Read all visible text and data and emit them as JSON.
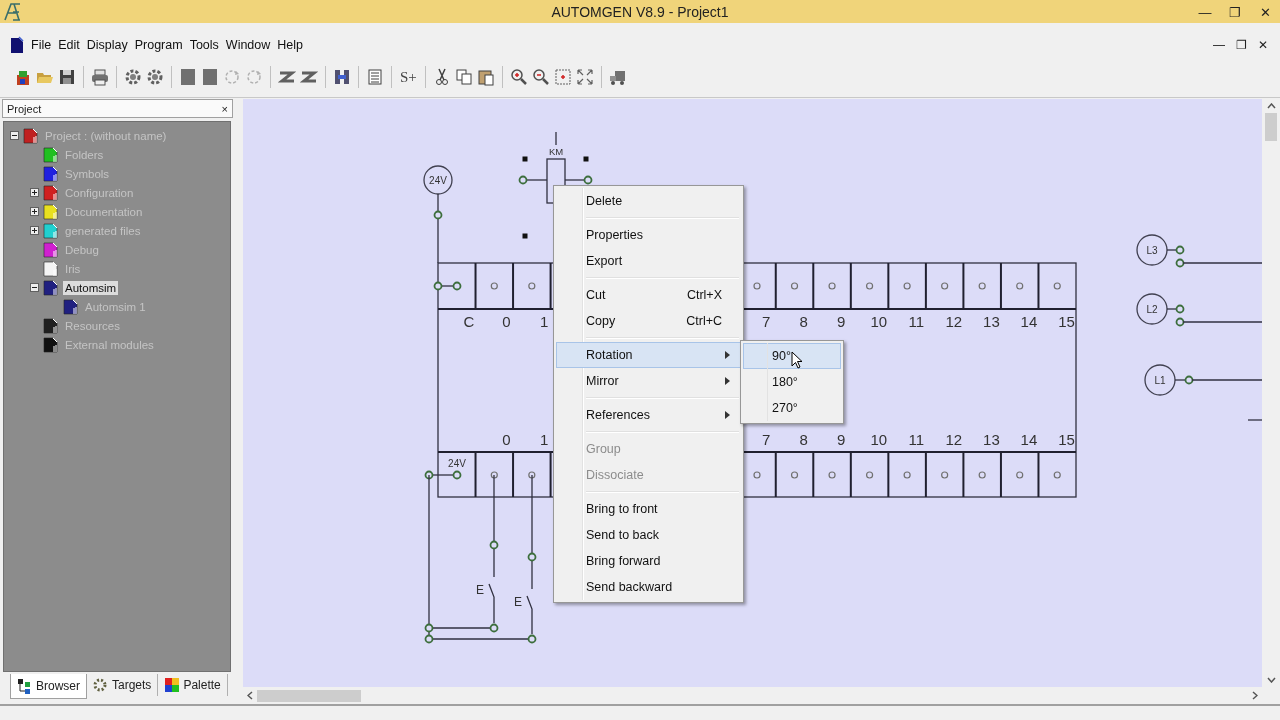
{
  "window": {
    "title": "AUTOMGEN V8.9 - Project1",
    "controls": [
      "—",
      "❐",
      "✕"
    ]
  },
  "menu_bar": {
    "items": [
      "File",
      "Edit",
      "Display",
      "Program",
      "Tools",
      "Window",
      "Help"
    ],
    "mdi_controls": [
      "—",
      "❐",
      "✕"
    ]
  },
  "toolbar": {
    "symbol_button": "S+"
  },
  "project_panel": {
    "title": "Project",
    "close": "×",
    "tree": [
      {
        "label": "Project : (without name)",
        "color": "#c02020",
        "expanded": true,
        "selected": false,
        "children": [
          {
            "label": "Folders",
            "color": "#20c020",
            "selected": false
          },
          {
            "label": "Symbols",
            "color": "#2020e0",
            "selected": false
          },
          {
            "label": "Configuration",
            "color": "#d02020",
            "expanded": false,
            "selected": false
          },
          {
            "label": "Documentation",
            "color": "#e8e020",
            "expanded": false,
            "selected": false
          },
          {
            "label": "generated files",
            "color": "#20d0d0",
            "expanded": false,
            "selected": false
          },
          {
            "label": "Debug",
            "color": "#d020d0",
            "selected": false
          },
          {
            "label": "Iris",
            "color": "#f4f4f4",
            "selected": false
          },
          {
            "label": "Automsim",
            "color": "#202080",
            "expanded": true,
            "selected": true,
            "children": [
              {
                "label": "Automsim 1",
                "color": "#202080",
                "selected": false
              }
            ]
          },
          {
            "label": "Resources",
            "color": "#202020",
            "selected": false
          },
          {
            "label": "External modules",
            "color": "#101010",
            "selected": false
          }
        ]
      }
    ],
    "tabs": [
      {
        "label": "Browser",
        "selected": true
      },
      {
        "label": "Targets",
        "selected": false
      },
      {
        "label": "Palette",
        "selected": false
      }
    ]
  },
  "diagram": {
    "supply_label": "24V",
    "coil_label": "KM",
    "output_row": {
      "labels_start": [
        "C",
        "0",
        "1"
      ],
      "labels_end": [
        "7",
        "8",
        "9",
        "10",
        "11",
        "12",
        "13",
        "14",
        "15"
      ]
    },
    "input_row": {
      "first_cell_label": "24V",
      "labels_start": [
        "0",
        "1"
      ],
      "labels_end": [
        "7",
        "8",
        "9",
        "10",
        "11",
        "12",
        "13",
        "14",
        "15"
      ]
    },
    "switch_labels": [
      "E",
      "E"
    ],
    "phases": [
      "L3",
      "L2",
      "L1"
    ]
  },
  "context_menu": {
    "groups": [
      [
        {
          "label": "Delete",
          "disabled": false,
          "selected": false
        }
      ],
      [
        {
          "label": "Properties",
          "disabled": false,
          "selected": false
        },
        {
          "label": "Export",
          "disabled": false,
          "selected": false
        }
      ],
      [
        {
          "label": "Cut",
          "shortcut": "Ctrl+X",
          "disabled": false,
          "selected": false
        },
        {
          "label": "Copy",
          "shortcut": "Ctrl+C",
          "disabled": false,
          "selected": false
        }
      ],
      [
        {
          "label": "Rotation",
          "submenu": true,
          "disabled": false,
          "selected": true
        },
        {
          "label": "Mirror",
          "submenu": true,
          "disabled": false,
          "selected": false
        }
      ],
      [
        {
          "label": "References",
          "submenu": true,
          "disabled": false,
          "selected": false
        }
      ],
      [
        {
          "label": "Group",
          "disabled": true,
          "selected": false
        },
        {
          "label": "Dissociate",
          "disabled": true,
          "selected": false
        }
      ],
      [
        {
          "label": "Bring to front",
          "disabled": false,
          "selected": false
        },
        {
          "label": "Send to back",
          "disabled": false,
          "selected": false
        },
        {
          "label": "Bring forward",
          "disabled": false,
          "selected": false
        },
        {
          "label": "Send backward",
          "disabled": false,
          "selected": false
        }
      ]
    ]
  },
  "submenu": {
    "items": [
      {
        "label": "90°",
        "selected": true
      },
      {
        "label": "180°",
        "selected": false
      },
      {
        "label": "270°",
        "selected": false
      }
    ]
  }
}
